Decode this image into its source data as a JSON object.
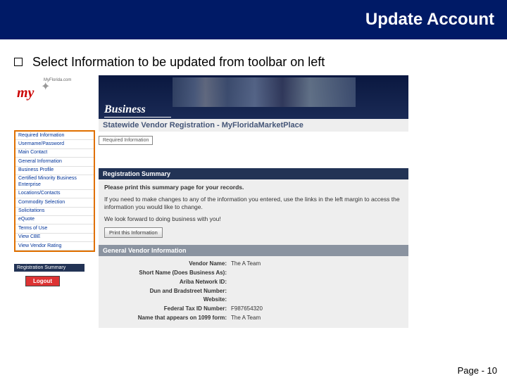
{
  "slide": {
    "title": "Update Account",
    "instruction": "Select Information to be updated from toolbar on left",
    "page_label": "Page - 10"
  },
  "logo": {
    "word": "my",
    "tag": "MyFlorida.com"
  },
  "banner": {
    "label": "Business"
  },
  "sidebar": {
    "items": [
      "Required Information",
      "Username/Password",
      "Main Contact",
      "General Information",
      "Business Profile",
      "Certified Minority Business Enterprise",
      "Locations/Contacts",
      "Commodity Selection",
      "Solicitations",
      "eQuote",
      "Terms of Use",
      "View CBE",
      "View Vendor Rating"
    ],
    "reg_summary": "Registration Summary",
    "logout": "Logout"
  },
  "page": {
    "heading": "Statewide Vendor Registration - MyFloridaMarketPlace",
    "breadcrumb": "Required Information",
    "section_title": "Registration Summary",
    "summary": {
      "line1": "Please print this summary page for your records.",
      "line2": "If you need to make changes to any of the information you entered, use the links in the left margin to access the information you would like to change.",
      "line3": "We look forward to doing business with you!",
      "print_btn": "Print this Information"
    },
    "gvi_title": "General Vendor Information",
    "fields": [
      {
        "label": "Vendor Name:",
        "value": "The A Team"
      },
      {
        "label": "Short Name (Does Business As):",
        "value": ""
      },
      {
        "label": "Ariba Network ID:",
        "value": ""
      },
      {
        "label": "Dun and Bradstreet Number:",
        "value": ""
      },
      {
        "label": "Website:",
        "value": ""
      },
      {
        "label": "Federal Tax ID Number:",
        "value": "F987654320"
      },
      {
        "label": "Name that appears on 1099 form:",
        "value": "The A Team"
      }
    ]
  }
}
